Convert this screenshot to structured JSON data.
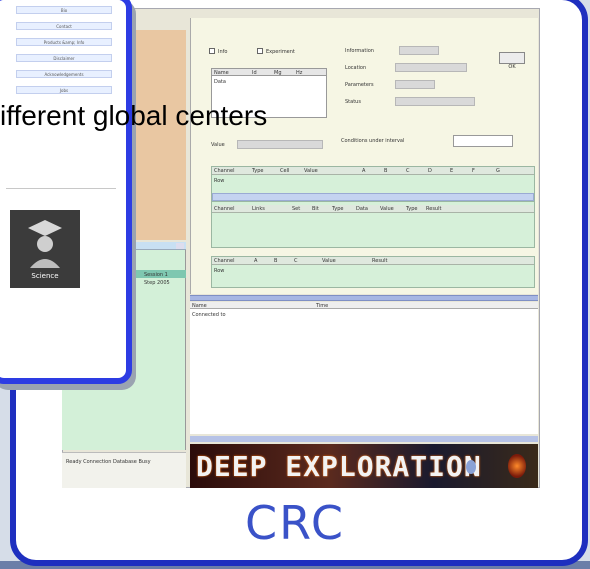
{
  "caption": "ifferent global centers",
  "logo_text": "CRC",
  "banner_text": "DEEP EXPLORATION",
  "overlay": {
    "menu_items": [
      "Bio",
      "Contact",
      "Products &amp; Info",
      "Disclaimer",
      "Acknowledgements",
      "Jobs"
    ],
    "tile_label": "Science"
  },
  "form": {
    "checkbox_1": "Info",
    "checkbox_2": "Experiment",
    "table1_headers": [
      "Name",
      "Id",
      "Mg",
      "Hz"
    ],
    "table1_row": "Data",
    "side_labels": [
      "Information",
      "Location",
      "Parameters",
      "Status"
    ],
    "button_label": "OK",
    "label_a": "Value",
    "label_b": "Conditions under interval",
    "grid_headers": [
      "Channel",
      "Type",
      "Cell",
      "Value",
      "A",
      "B",
      "C",
      "D",
      "E",
      "F",
      "G"
    ],
    "grid_row": "Row",
    "grid2_headers": [
      "Channel",
      "Links",
      "Set",
      "Bit",
      "Type",
      "Data",
      "Value",
      "Type",
      "Result"
    ],
    "grid3_headers": [
      "Channel",
      "A",
      "B",
      "C",
      "Value",
      "Result"
    ],
    "log_headers": [
      "Name",
      "Time"
    ],
    "log_first": "Connected to"
  },
  "left_tree": [
    "Session 1",
    "Step 2005"
  ],
  "status_text": "Ready  Connection  Database  Busy"
}
